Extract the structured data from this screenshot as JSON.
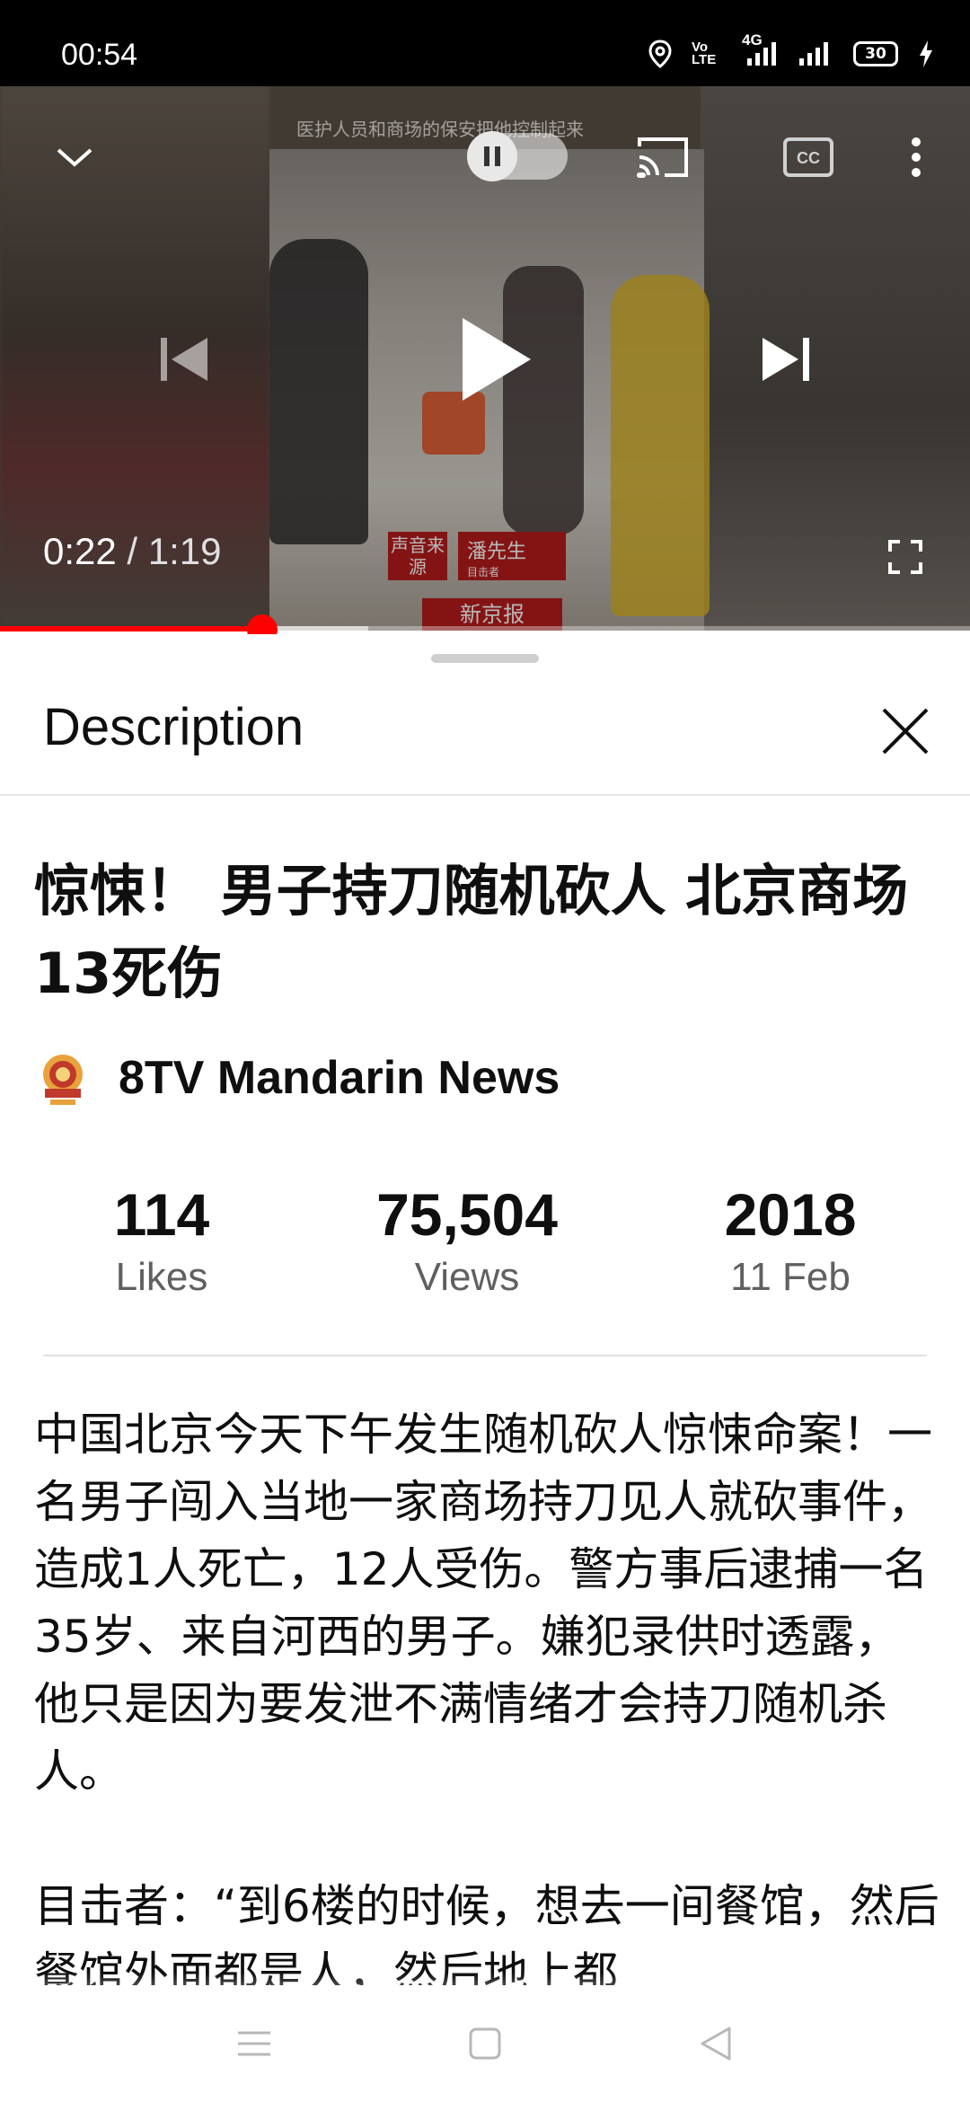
{
  "status_bar": {
    "time": "00:54",
    "network_badge": "Vo LTE",
    "data_type": "4G",
    "battery": "30"
  },
  "player": {
    "current_time": "0:22",
    "separator": " / ",
    "duration": "1:19",
    "progress_fraction": 0.27,
    "buffer_fraction": 0.38,
    "autoplay_on": false,
    "overlay_subtitle": "医护人员和商场的保安把他控制起来",
    "overlay_badges": [
      "声音来源",
      "潘先生",
      "目击者",
      "新京报"
    ],
    "accent_color": "#ff0000"
  },
  "panel": {
    "title": "Description",
    "video_title": "惊悚！ 男子持刀随机砍人 北京商场13死伤",
    "channel_name": "8TV Mandarin News",
    "stats": {
      "likes_value": "114",
      "likes_label": "Likes",
      "views_value": "75,504",
      "views_label": "Views",
      "year_value": "2018",
      "date_label": "11 Feb"
    },
    "description": "中国北京今天下午发生随机砍人惊悚命案！一名男子闯入当地一家商场持刀见人就砍事件，造成1人死亡，12人受伤。警方事后逮捕一名35岁、来自河西的男子。嫌犯录供时透露，他只是因为要发泄不满情绪才会持刀随机杀人。\n\n目击者：“到6楼的时候，想去一间餐馆，然后餐馆外面都是人，然后地上都"
  },
  "icons": {
    "collapse": "chevron-down-icon",
    "autoplay": "pause-icon",
    "cast": "cast-icon",
    "captions": "cc-icon",
    "more": "more-vert-icon",
    "previous": "skip-previous-icon",
    "play": "play-icon",
    "next": "skip-next-icon",
    "fullscreen": "fullscreen-icon",
    "close": "close-icon"
  }
}
